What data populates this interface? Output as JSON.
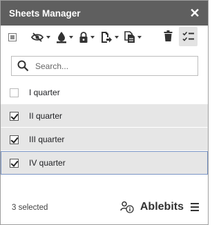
{
  "header": {
    "title": "Sheets Manager",
    "close_label": "✕"
  },
  "search": {
    "value": "",
    "placeholder": "Search..."
  },
  "sheets": [
    {
      "label": "I quarter",
      "checked": false
    },
    {
      "label": "II quarter",
      "checked": true
    },
    {
      "label": "III quarter",
      "checked": true
    },
    {
      "label": "IV quarter",
      "checked": true
    }
  ],
  "footer": {
    "status": "3 selected",
    "brand": "Ablebits"
  },
  "colors": {
    "titlebar": "#5f5f5f",
    "selected_row": "#e6e6e6",
    "focus_border": "#7994c5"
  },
  "icons": [
    "eye-slash-icon",
    "fill-color-icon",
    "lock-icon",
    "move-copy-icon",
    "duplicate-icon",
    "trash-icon",
    "checklist-icon",
    "search-icon",
    "user-info-icon",
    "menu-icon"
  ]
}
